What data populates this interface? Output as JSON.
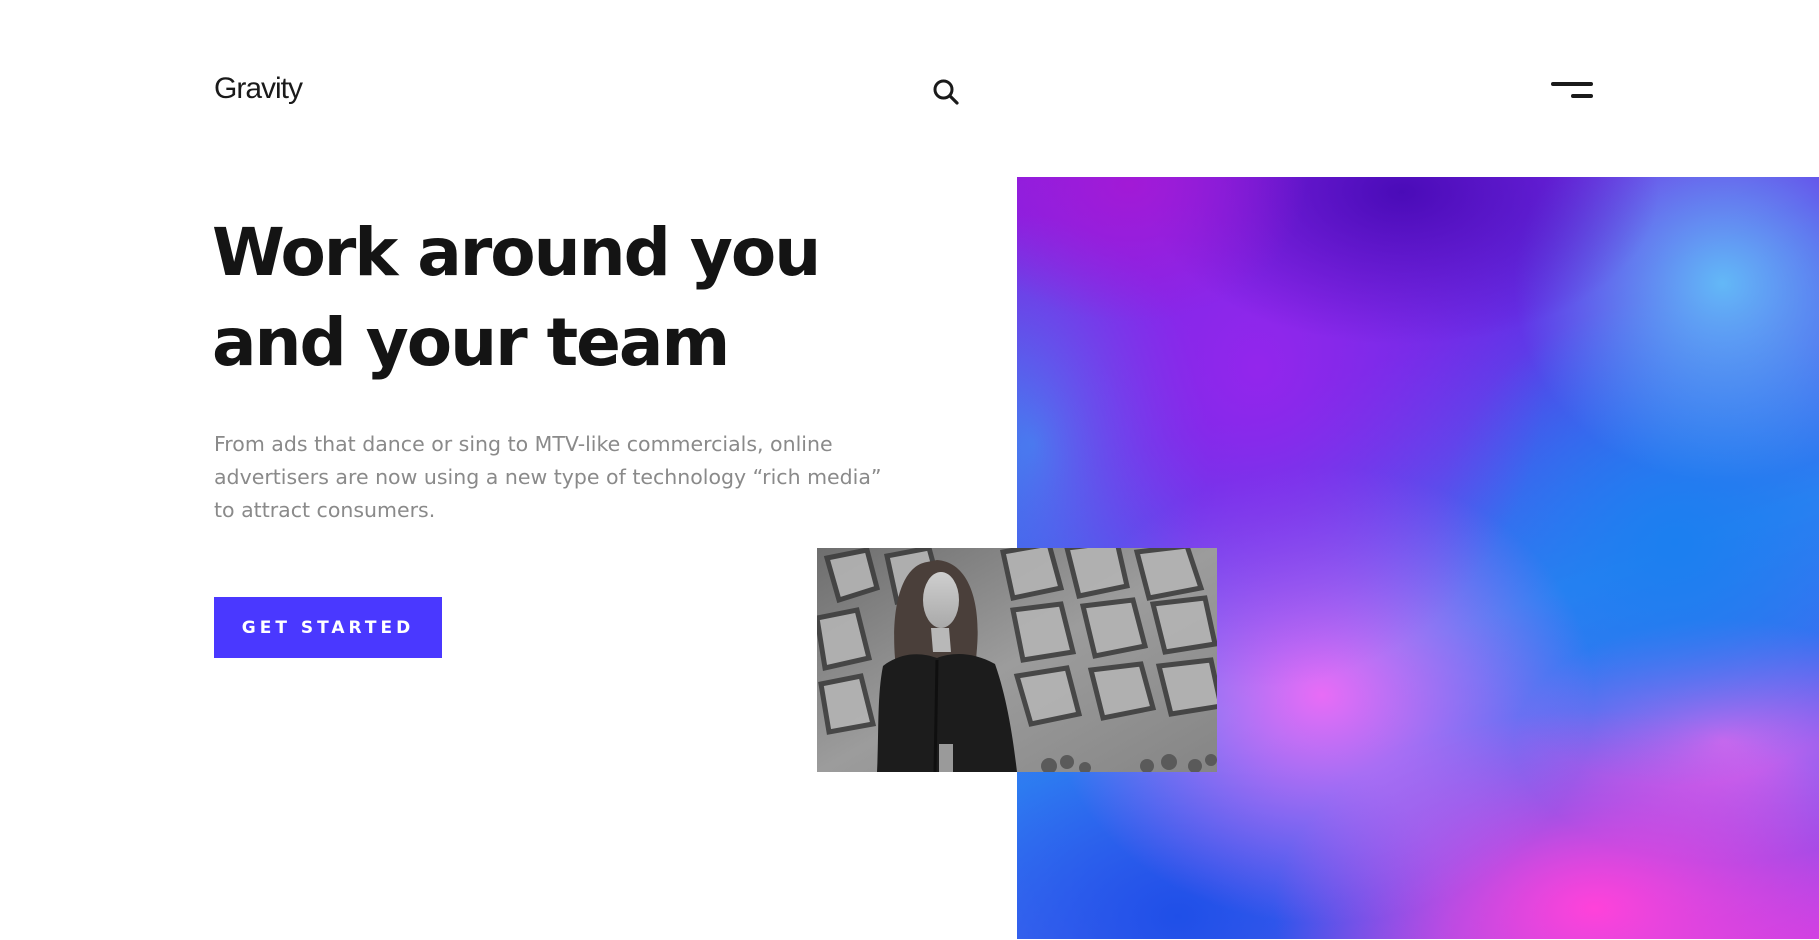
{
  "header": {
    "logo_text": "Gravity",
    "search_icon": "search-icon",
    "menu_icon": "hamburger-menu-icon"
  },
  "hero": {
    "title_lines": [
      "Work around you",
      "and your team"
    ],
    "description_lines": [
      "From ads that dance or sing to MTV-like commercials, online",
      "advertisers are now using a new type of technology “rich media”",
      "to attract consumers."
    ],
    "cta_label": "GET STARTED"
  },
  "colors": {
    "accent": "#4a38ff",
    "heading": "#141414",
    "body_text": "#8a8a8a",
    "background": "#ffffff",
    "gradient_purple": "#9326ec",
    "gradient_blue": "#1b7ff0",
    "gradient_pink": "#ff42da"
  },
  "media": {
    "photo_description_icon": "portrait-photo"
  }
}
